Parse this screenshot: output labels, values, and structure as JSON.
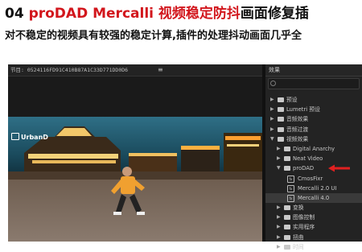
{
  "headline": {
    "prefix": "04 ",
    "red": "proDAD Mercalli 视频稳定防抖",
    "suffix": "画面修复插"
  },
  "subline": "对不稳定的视频具有较强的稳定计算,插件的处理抖动画面几乎全",
  "monitor": {
    "title": "节目: 0524116FD91C410B87A1C33D771DD0D6",
    "menu": "≡",
    "watermark": "UrbanD"
  },
  "effects_panel": {
    "title": "效果",
    "search_placeholder": "",
    "items": [
      {
        "label": "预设",
        "level": 0,
        "type": "folder",
        "expanded": false
      },
      {
        "label": "Lumetri 预设",
        "level": 0,
        "type": "folder",
        "expanded": false
      },
      {
        "label": "音频效果",
        "level": 0,
        "type": "folder",
        "expanded": false
      },
      {
        "label": "音频过渡",
        "level": 0,
        "type": "folder",
        "expanded": false
      },
      {
        "label": "视频效果",
        "level": 0,
        "type": "folder",
        "expanded": true
      },
      {
        "label": "Digital Anarchy",
        "level": 1,
        "type": "folder",
        "expanded": false
      },
      {
        "label": "Neat Video",
        "level": 1,
        "type": "folder",
        "expanded": false
      },
      {
        "label": "proDAD",
        "level": 1,
        "type": "folder",
        "expanded": true,
        "highlighted": true
      },
      {
        "label": "CmosFixr",
        "level": 2,
        "type": "effect"
      },
      {
        "label": "Mercalli 2.0 UI",
        "level": 2,
        "type": "effect"
      },
      {
        "label": "Mercalli 4.0",
        "level": 2,
        "type": "effect",
        "highlighted": true
      },
      {
        "label": "变换",
        "level": 1,
        "type": "folder",
        "expanded": false
      },
      {
        "label": "图像控制",
        "level": 1,
        "type": "folder",
        "expanded": false
      },
      {
        "label": "实用程序",
        "level": 1,
        "type": "folder",
        "expanded": false
      },
      {
        "label": "扭曲",
        "level": 1,
        "type": "folder",
        "expanded": false
      },
      {
        "label": "时间",
        "level": 1,
        "type": "folder",
        "expanded": false
      }
    ]
  },
  "colors": {
    "headline_red": "#d2161c",
    "pointer_red": "#e02020"
  }
}
